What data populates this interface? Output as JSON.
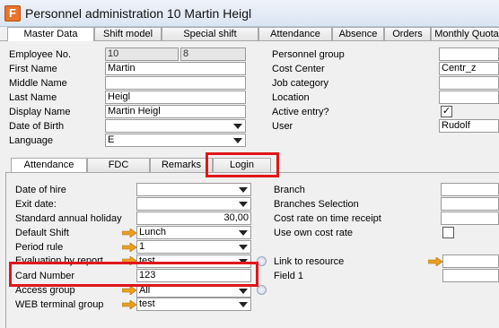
{
  "window": {
    "title": "Personnel administration 10 Martin  Heigl",
    "icon_letter": "F"
  },
  "top_tabs": [
    "Master Data",
    "Shift model",
    "Special shift",
    "Attendance",
    "Absence",
    "Orders",
    "Monthly Quota"
  ],
  "master": {
    "employee_no_label": "Employee No.",
    "employee_no": "10",
    "employee_no2": "8",
    "first_name_label": "First Name",
    "first_name": "Martin",
    "middle_name_label": "Middle Name",
    "middle_name": "",
    "last_name_label": "Last Name",
    "last_name": "Heigl",
    "display_name_label": "Display Name",
    "display_name": "Martin  Heigl",
    "dob_label": "Date of Birth",
    "dob": "",
    "language_label": "Language",
    "language": "E",
    "personnel_group_label": "Personnel group",
    "personnel_group": "",
    "cost_center_label": "Cost Center",
    "cost_center": "Centr_z",
    "job_category_label": "Job category",
    "job_category": "",
    "location_label": "Location",
    "location": "",
    "active_label": "Active entry?",
    "active_mark": "✓",
    "user_label": "User",
    "user": "Rudolf"
  },
  "sub_tabs": [
    "Attendance",
    "FDC",
    "Remarks",
    "Login"
  ],
  "attendance": {
    "date_of_hire_label": "Date of hire",
    "exit_date_label": "Exit date:",
    "holiday_label": "Standard annual holiday",
    "holiday_value": "30,00",
    "default_shift_label": "Default Shift",
    "default_shift": "Lunch",
    "period_rule_label": "Period rule",
    "period_rule": "1",
    "evaluation_label": "Evaluation by report",
    "evaluation": "test",
    "card_number_label": "Card Number",
    "card_number": "123",
    "access_group_label": "Access group",
    "access_group": "All",
    "web_terminal_label": "WEB terminal group",
    "web_terminal": "test",
    "branch_label": "Branch",
    "branches_selection_label": "Branches Selection",
    "cost_rate_label": "Cost rate on time receipt",
    "own_cost_rate_label": "Use own cost rate",
    "link_resource_label": "Link to resource",
    "field1_label": "Field 1"
  },
  "colors": {
    "highlight": "#e0161b",
    "arrow": "#e8a020"
  }
}
